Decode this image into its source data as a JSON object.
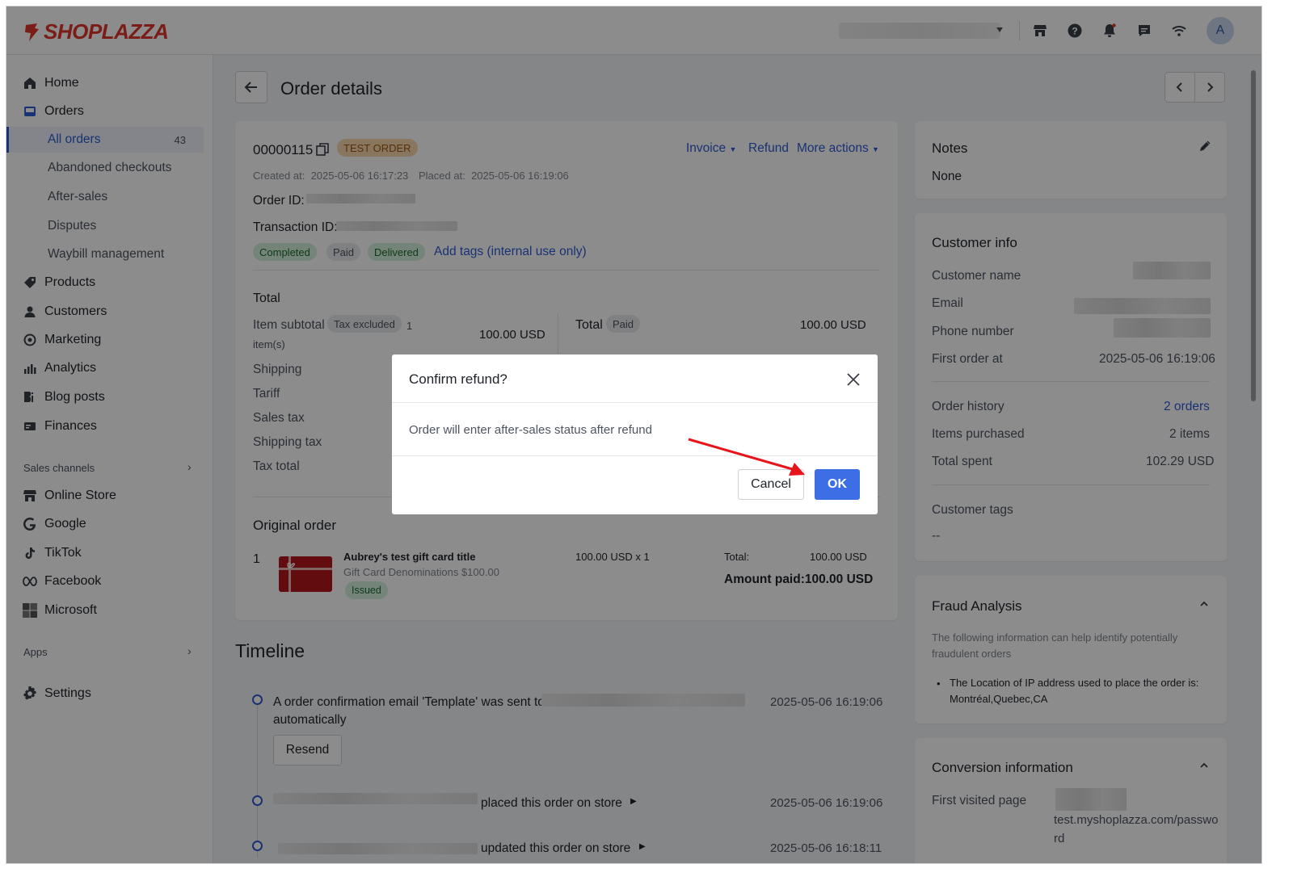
{
  "brand": {
    "name": "SHOPLAZZA",
    "color": "#e0342b"
  },
  "topbar": {
    "avatar_letter": "A",
    "icons": [
      "store-icon",
      "help-icon",
      "bell-icon",
      "chat-icon",
      "wifi-icon"
    ]
  },
  "sidebar": {
    "home": "Home",
    "orders": "Orders",
    "all_orders": "All orders",
    "all_orders_count": "43",
    "abandoned": "Abandoned checkouts",
    "after_sales": "After-sales",
    "disputes": "Disputes",
    "waybill": "Waybill management",
    "products": "Products",
    "customers": "Customers",
    "marketing": "Marketing",
    "analytics": "Analytics",
    "blog": "Blog posts",
    "finances": "Finances",
    "sales_channels": "Sales channels",
    "online_store": "Online Store",
    "google": "Google",
    "tiktok": "TikTok",
    "facebook": "Facebook",
    "microsoft": "Microsoft",
    "apps": "Apps",
    "settings": "Settings"
  },
  "page": {
    "title": "Order details"
  },
  "order": {
    "number": "00000115",
    "test_tag": "TEST ORDER",
    "invoice": "Invoice",
    "refund": "Refund",
    "more_actions": "More actions",
    "created_label": "Created at:",
    "created_value": "2025-05-06 16:17:23",
    "placed_label": "Placed at:",
    "placed_value": "2025-05-06 16:19:06",
    "order_id_label": "Order ID:",
    "transaction_id_label": "Transaction ID:",
    "tags": [
      "Completed",
      "Paid",
      "Delivered"
    ],
    "add_tags": "Add tags (internal use only)",
    "total_heading": "Total",
    "item_subtotal": "Item subtotal",
    "tax_excluded": "Tax excluded",
    "items_count": "1",
    "items_word": "item(s)",
    "subtotal_value": "100.00 USD",
    "shipping": "Shipping",
    "tariff": "Tariff",
    "sales_tax": "Sales tax",
    "shipping_tax": "Shipping tax",
    "tax_total": "Tax total",
    "total_label": "Total",
    "total_paid_tag": "Paid",
    "total_value": "100.00 USD",
    "original_order": "Original order",
    "line_index": "1",
    "product_title": "Aubrey's test gift card title",
    "product_variant": "Gift Card Denominations $100.00",
    "product_status": "Issued",
    "unit_price": "100.00 USD x 1",
    "line_total_label": "Total:",
    "line_total_value": "100.00 USD",
    "amount_paid": "Amount paid:100.00 USD"
  },
  "timeline": {
    "title": "Timeline",
    "events": [
      {
        "text": "A order confirmation email 'Template' was sent to",
        "text2": "automatically",
        "time": "2025-05-06 16:19:06",
        "button": "Resend"
      },
      {
        "text": "placed this order on store",
        "time": "2025-05-06 16:19:06"
      },
      {
        "text": "updated this order on store",
        "time": "2025-05-06 16:18:11"
      }
    ]
  },
  "notes": {
    "title": "Notes",
    "value": "None"
  },
  "customer": {
    "title": "Customer info",
    "name_label": "Customer name",
    "email_label": "Email",
    "phone_label": "Phone number",
    "first_order_label": "First order at",
    "first_order_value": "2025-05-06 16:19:06",
    "history_label": "Order history",
    "history_value": "2 orders",
    "items_label": "Items purchased",
    "items_value": "2 items",
    "spent_label": "Total spent",
    "spent_value": "102.29 USD",
    "tags_label": "Customer tags",
    "tags_value": "--"
  },
  "fraud": {
    "title": "Fraud Analysis",
    "desc": "The following information can help identify potentially fraudulent orders",
    "bullet_line1": "The Location of IP address used to place the order is:",
    "bullet_line2": "Montréal,Quebec,CA"
  },
  "conversion": {
    "title": "Conversion information",
    "first_visited_label": "First visited page",
    "first_visited_line1": "test.myshoplazza.com/passwo",
    "first_visited_line2": "rd"
  },
  "modal": {
    "title": "Confirm refund?",
    "body": "Order will enter after-sales status after refund",
    "cancel": "Cancel",
    "ok": "OK"
  },
  "colors": {
    "accent": "#3d6ee6",
    "link": "#2d5bd1",
    "arrow": "#e8141c"
  }
}
